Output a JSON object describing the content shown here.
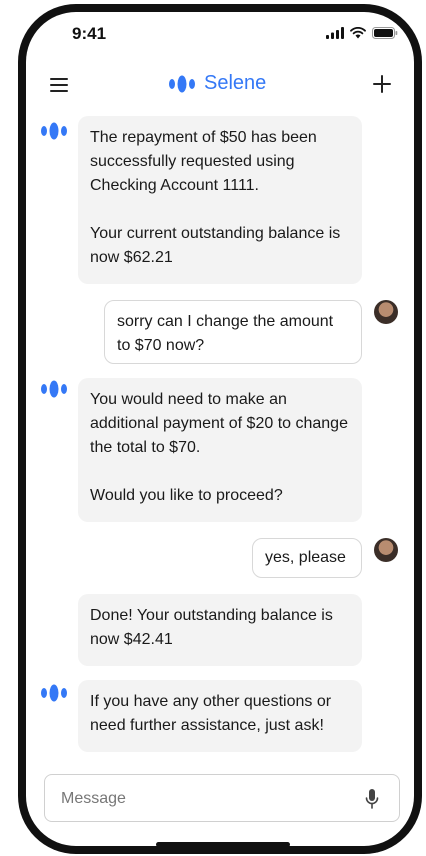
{
  "status_bar": {
    "time": "9:41"
  },
  "header": {
    "title": "Selene",
    "menu_icon": "hamburger-menu-icon",
    "new_icon": "plus-icon"
  },
  "colors": {
    "accent": "#3478f6",
    "bot_bubble": "#f3f3f3",
    "user_bubble_border": "#d8d8d8"
  },
  "messages": [
    {
      "from": "bot",
      "paragraphs": [
        "The repayment of $50 has been successfully requested using Checking Account 1111.",
        "Your current outstanding balance is now $62.21"
      ]
    },
    {
      "from": "user",
      "text": "sorry can I change the amount to $70 now?"
    },
    {
      "from": "bot",
      "paragraphs": [
        "You would need to make an additional payment of $20 to change the total to $70.",
        "Would you like to proceed?"
      ]
    },
    {
      "from": "user",
      "text": "yes, please"
    },
    {
      "from": "bot",
      "paragraphs": [
        "Done! Your outstanding balance is now $42.41"
      ]
    },
    {
      "from": "bot",
      "paragraphs": [
        "If you have any other questions or need further assistance, just ask!"
      ]
    }
  ],
  "composer": {
    "placeholder": "Message",
    "mic_icon": "microphone-icon"
  }
}
